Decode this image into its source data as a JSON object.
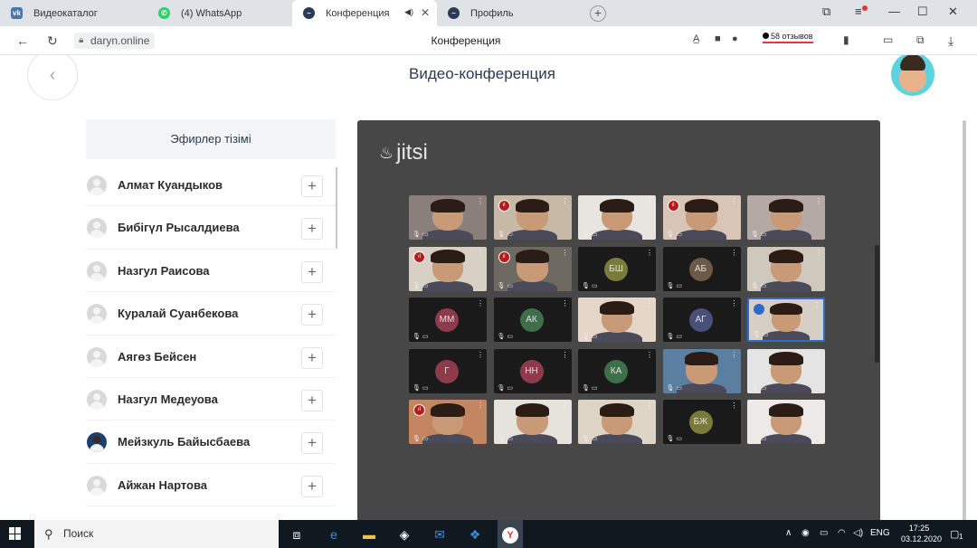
{
  "browser": {
    "tabs": [
      {
        "label": "Видеокаталог",
        "icon": "vk-icon",
        "color": "#4a76a8"
      },
      {
        "label": "(4) WhatsApp",
        "icon": "whatsapp-icon",
        "color": "#25d366"
      },
      {
        "label": "Конференция",
        "icon": "conference-icon",
        "color": "#2b3a55",
        "active": true
      },
      {
        "label": "Профиль",
        "icon": "profile-icon",
        "color": "#2b3a55"
      }
    ],
    "url": "daryn.online",
    "page_title": "Конференция",
    "reviews": "58 отзывов"
  },
  "page": {
    "title": "Видео-конференция",
    "sidebar_title": "Эфирлер тізімі",
    "participants": [
      {
        "name": "Алмат Куандыков",
        "photo": false
      },
      {
        "name": "Бибігүл Рысалдиева",
        "photo": false
      },
      {
        "name": "Назгул Раисова",
        "photo": false
      },
      {
        "name": "Куралай Суанбекова",
        "photo": false
      },
      {
        "name": "Аягөз Бейсен",
        "photo": false
      },
      {
        "name": "Назгул Медеуова",
        "photo": false
      },
      {
        "name": "Мейзкуль Байысбаева",
        "photo": true
      },
      {
        "name": "Айжан Нартова",
        "photo": false
      }
    ],
    "add_symbol": "+"
  },
  "video": {
    "brand": "jitsi",
    "tiles": [
      {
        "type": "cam",
        "bg": "#8a7f7a",
        "signal": false
      },
      {
        "type": "cam",
        "bg": "#c7b9a6",
        "signal": true
      },
      {
        "type": "cam",
        "bg": "#e8e4df",
        "signal": false
      },
      {
        "type": "cam",
        "bg": "#d9c5b8",
        "signal": true
      },
      {
        "type": "cam",
        "bg": "#b5a9a5",
        "signal": false
      },
      {
        "type": "cam",
        "bg": "#d8d0c4",
        "signal": true
      },
      {
        "type": "cam",
        "bg": "#6e6a62",
        "signal": true
      },
      {
        "type": "initials",
        "text": "БШ",
        "color": "#7a7a3a"
      },
      {
        "type": "initials",
        "text": "АБ",
        "color": "#6b5a48"
      },
      {
        "type": "cam",
        "bg": "#cfc8bc",
        "signal": false
      },
      {
        "type": "initials",
        "text": "ММ",
        "color": "#8e3a4a"
      },
      {
        "type": "initials",
        "text": "АК",
        "color": "#3f6e4a"
      },
      {
        "type": "cam",
        "bg": "#e5d6c8",
        "signal": false
      },
      {
        "type": "initials",
        "text": "АГ",
        "color": "#4a4e7a"
      },
      {
        "type": "cam",
        "bg": "#d7cfc5",
        "speaker": true
      },
      {
        "type": "initials",
        "text": "Г",
        "color": "#8e3a4a"
      },
      {
        "type": "initials",
        "text": "НН",
        "color": "#8e3a4a"
      },
      {
        "type": "initials",
        "text": "КА",
        "color": "#3f6e4a"
      },
      {
        "type": "cam",
        "bg": "#5a7fa0",
        "signal": false
      },
      {
        "type": "cam",
        "bg": "#e4e4e4",
        "signal": false
      },
      {
        "type": "cam",
        "bg": "#c48660",
        "signal": true
      },
      {
        "type": "cam",
        "bg": "#e6e2dc",
        "signal": false
      },
      {
        "type": "cam",
        "bg": "#ded5c7",
        "signal": false
      },
      {
        "type": "initials",
        "text": "БЖ",
        "color": "#7a7a3a"
      },
      {
        "type": "cam",
        "bg": "#ece9e6",
        "signal": false
      }
    ]
  },
  "taskbar": {
    "search": "Поиск",
    "lang": "ENG",
    "time": "17:25",
    "date": "03.12.2020",
    "notifications": "1"
  }
}
